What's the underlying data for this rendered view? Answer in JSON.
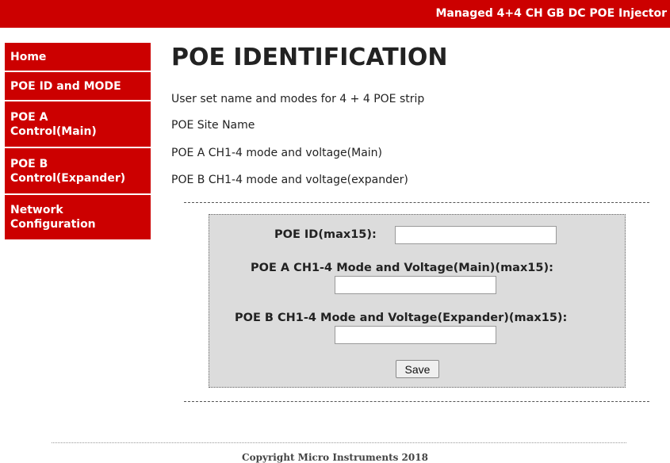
{
  "header": {
    "title": "Managed 4+4 CH GB DC POE Injector",
    "background_color": "#cc0000"
  },
  "sidebar": {
    "items": [
      {
        "label": "Home"
      },
      {
        "label": "POE ID and MODE"
      },
      {
        "label": "POE A\nControl(Main)"
      },
      {
        "label": "POE B\nControl(Expander)"
      },
      {
        "label": "Network\nConfiguration"
      }
    ]
  },
  "main": {
    "title": "POE IDENTIFICATION",
    "description_lines": [
      "User set name and modes for 4 + 4 POE strip",
      "POE Site Name",
      "POE A CH1-4 mode and voltage(Main)",
      "POE B CH1-4 mode and voltage(expander)"
    ]
  },
  "form": {
    "poe_id_label": "POE ID(max15):",
    "poe_id_value": "",
    "poe_a_label": "POE A CH1-4 Mode and Voltage(Main)(max15):",
    "poe_a_value": "",
    "poe_b_label": "POE B CH1-4 Mode and Voltage(Expander)(max15):",
    "poe_b_value": "",
    "save_label": "Save",
    "background_color": "#dcdcdc"
  },
  "footer": {
    "copyright": "Copyright Micro Instruments 2018"
  }
}
